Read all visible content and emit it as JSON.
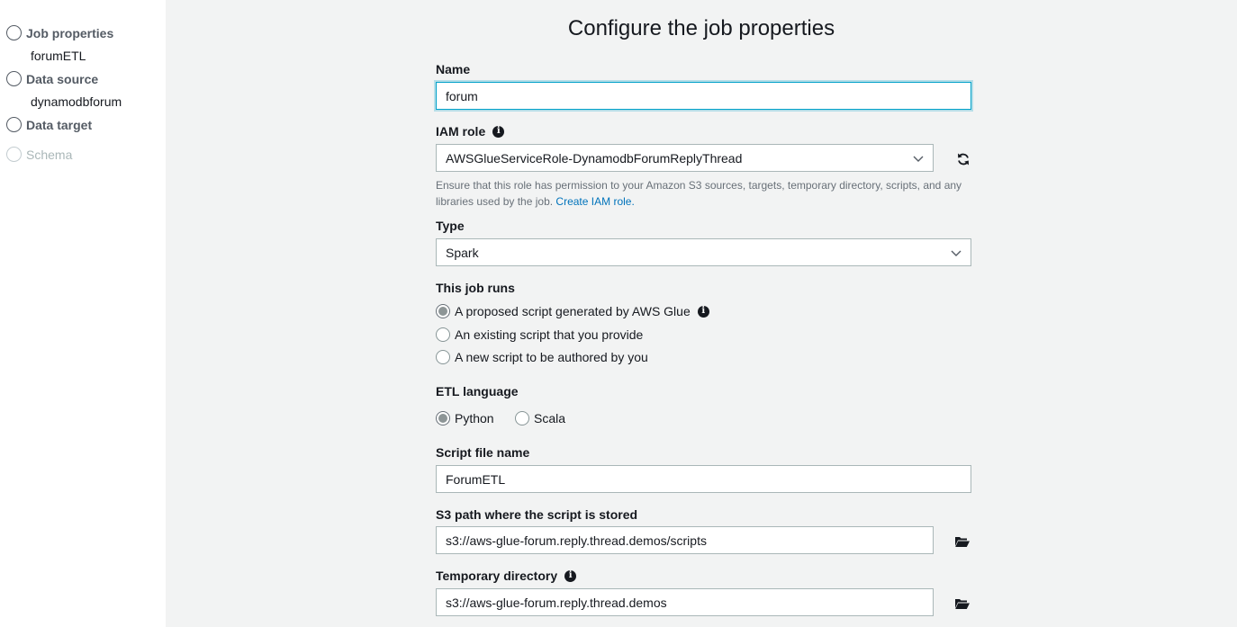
{
  "sidebar": {
    "steps": [
      {
        "label": "Job properties",
        "sub": "forumETL"
      },
      {
        "label": "Data source",
        "sub": "dynamodbforum"
      },
      {
        "label": "Data target"
      },
      {
        "label": "Schema",
        "disabled": true
      }
    ]
  },
  "page": {
    "title": "Configure the job properties"
  },
  "form": {
    "name": {
      "label": "Name",
      "value": "forum"
    },
    "iam_role": {
      "label": "IAM role",
      "value": "AWSGlueServiceRole-DynamodbForumReplyThread",
      "help": "Ensure that this role has permission to your Amazon S3 sources, targets, temporary directory, scripts, and any libraries used by the job.",
      "help_link": "Create IAM role."
    },
    "type": {
      "label": "Type",
      "value": "Spark"
    },
    "job_runs": {
      "label": "This job runs",
      "options": [
        "A proposed script generated by AWS Glue",
        "An existing script that you provide",
        "A new script to be authored by you"
      ],
      "selected": 0
    },
    "etl_language": {
      "label": "ETL language",
      "options": [
        "Python",
        "Scala"
      ],
      "selected": 0
    },
    "script_file": {
      "label": "Script file name",
      "value": "ForumETL"
    },
    "s3_path": {
      "label": "S3 path where the script is stored",
      "value": "s3://aws-glue-forum.reply.thread.demos/scripts"
    },
    "temp_dir": {
      "label": "Temporary directory",
      "value": "s3://aws-glue-forum.reply.thread.demos"
    }
  },
  "icons": {
    "step": "circle-outline",
    "info": "info-icon",
    "refresh": "refresh-icon",
    "folder": "folder-open-icon",
    "dropdown": "chevron-down-icon"
  },
  "colors": {
    "focus": "#00a1c9",
    "link": "#0073bb",
    "background": "#f2f3f3"
  }
}
